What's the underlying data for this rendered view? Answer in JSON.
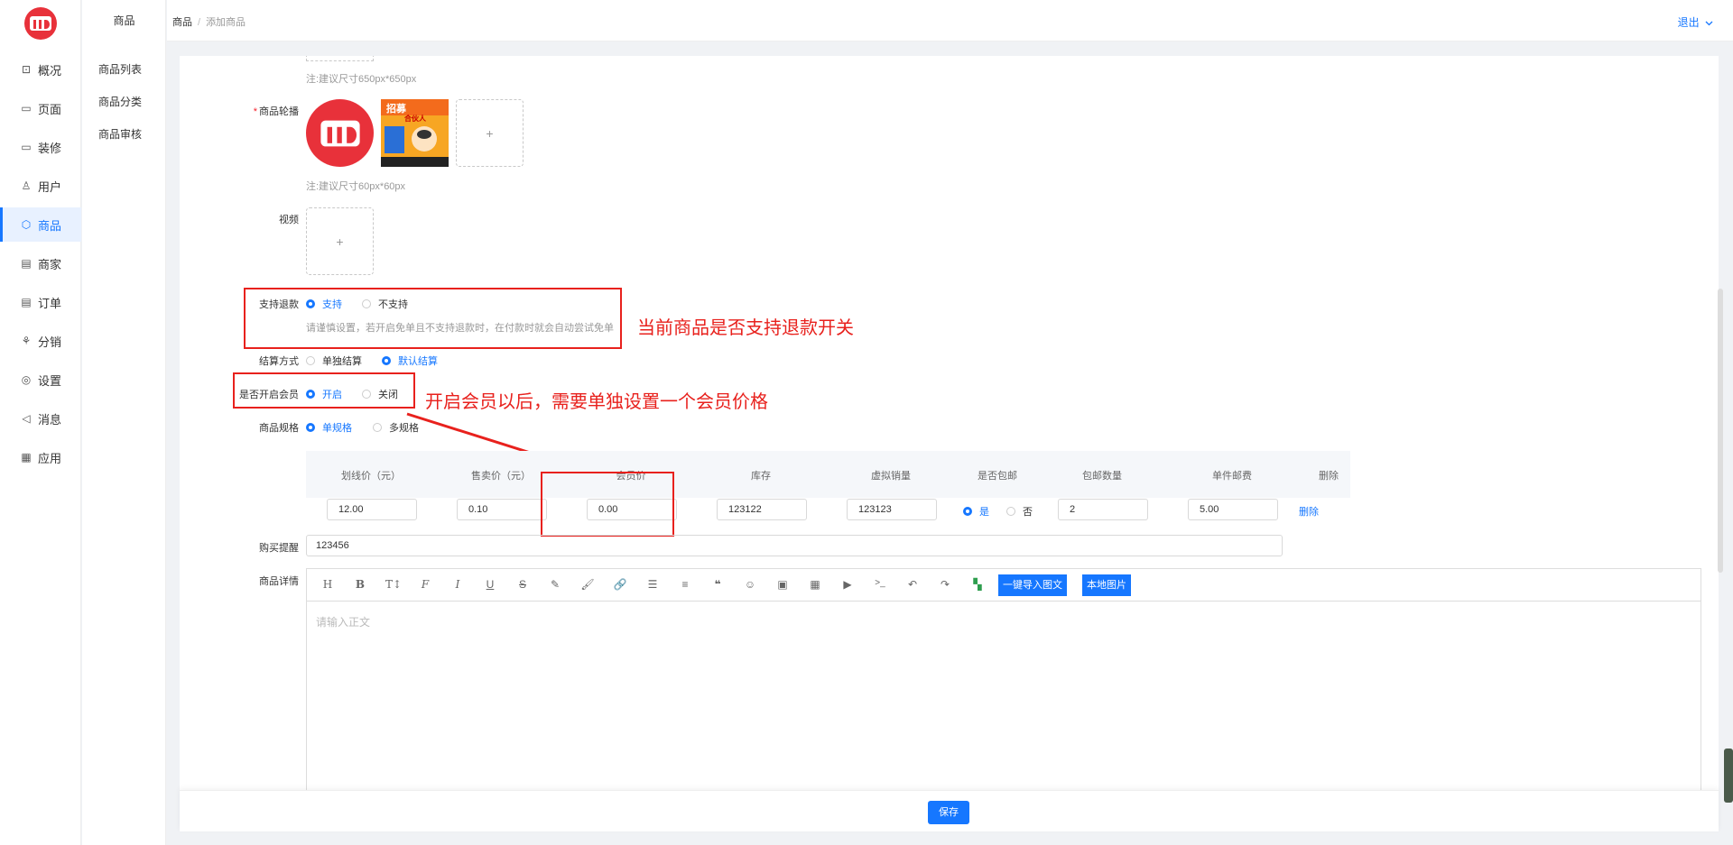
{
  "brand": {
    "accent": "#1677ff",
    "logo_color": "#e8313a",
    "annotation_color": "#e8211d"
  },
  "sidebar": {
    "items": [
      {
        "label": "概况",
        "icon": "chart-icon"
      },
      {
        "label": "页面",
        "icon": "page-icon"
      },
      {
        "label": "装修",
        "icon": "decorate-icon"
      },
      {
        "label": "用户",
        "icon": "user-icon"
      },
      {
        "label": "商品",
        "icon": "cube-icon",
        "active": true
      },
      {
        "label": "商家",
        "icon": "store-icon"
      },
      {
        "label": "订单",
        "icon": "order-icon"
      },
      {
        "label": "分销",
        "icon": "distribution-icon"
      },
      {
        "label": "设置",
        "icon": "settings-icon"
      },
      {
        "label": "消息",
        "icon": "message-icon"
      },
      {
        "label": "应用",
        "icon": "apps-icon"
      }
    ]
  },
  "subnav": {
    "title": "商品",
    "items": [
      "商品列表",
      "商品分类",
      "商品审核"
    ]
  },
  "header": {
    "breadcrumb": [
      "商品",
      "添加商品"
    ],
    "logout": "退出"
  },
  "form": {
    "cover_hint": "注:建议尺寸650px*650px",
    "carousel_label": "商品轮播",
    "carousel_hint": "注:建议尺寸60px*60px",
    "video_label": "视频",
    "refund": {
      "label": "支持退款",
      "options": [
        "支持",
        "不支持"
      ],
      "selected": "支持",
      "hint": "请谨慎设置，若开启免单且不支持退款时，在付款时就会自动尝试免单"
    },
    "settlement": {
      "label": "结算方式",
      "options": [
        "单独结算",
        "默认结算"
      ],
      "selected": "默认结算"
    },
    "member": {
      "label": "是否开启会员",
      "options": [
        "开启",
        "关闭"
      ],
      "selected": "开启"
    },
    "spec": {
      "label": "商品规格",
      "options": [
        "单规格",
        "多规格"
      ],
      "selected": "单规格"
    },
    "spec_table": {
      "headers": [
        "划线价（元）",
        "售卖价（元）",
        "会员价",
        "库存",
        "虚拟销量",
        "是否包邮",
        "包邮数量",
        "单件邮费",
        "删除"
      ],
      "row": {
        "list_price": "12.00",
        "sale_price": "0.10",
        "member_price": "0.00",
        "stock": "123122",
        "virtual_sales": "123123",
        "free_shipping_options": [
          "是",
          "否"
        ],
        "free_shipping_selected": "是",
        "free_qty": "2",
        "unit_postage": "5.00",
        "delete": "删除"
      }
    },
    "purchase_note": {
      "label": "购买提醒",
      "value": "123456"
    },
    "detail": {
      "label": "商品详情",
      "placeholder": "请输入正文",
      "import_button": "一键导入图文",
      "local_image_button": "本地图片"
    }
  },
  "annotations": {
    "refund": "当前商品是否支持退款开关",
    "member": "开启会员以后，需要单独设置一个会员价格"
  },
  "carousel_image_text": {
    "line1": "招募",
    "line2": "合伙人"
  },
  "footer": {
    "save": "保存"
  }
}
